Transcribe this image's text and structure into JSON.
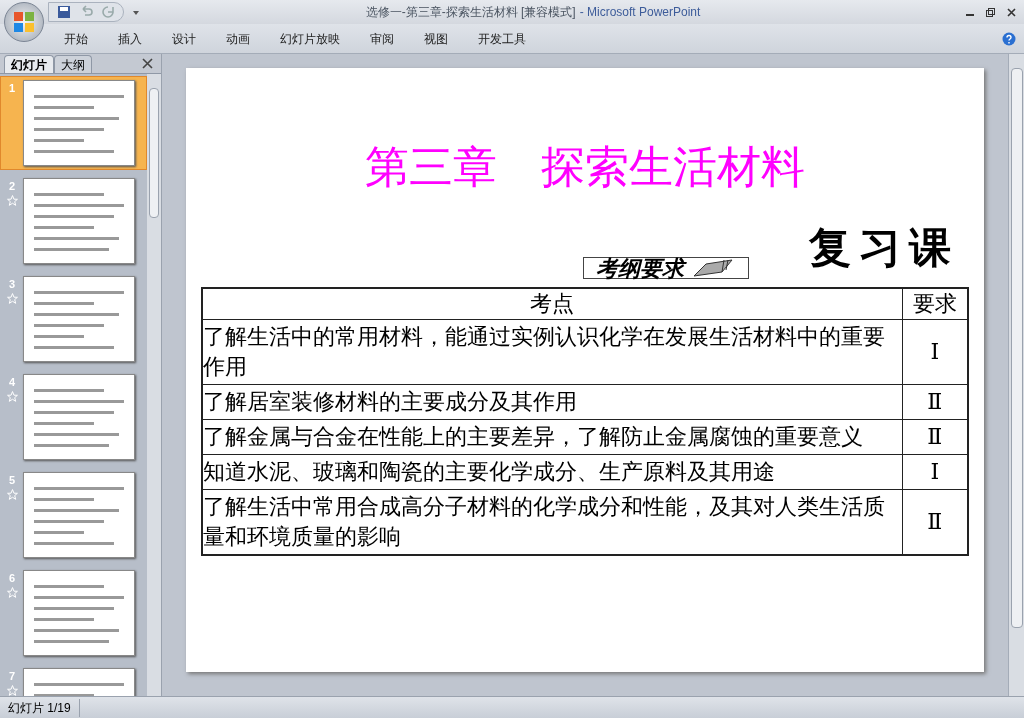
{
  "window": {
    "title": "选修一-第三章-探索生活材料 [兼容模式]",
    "separator": "-",
    "app": "Microsoft PowerPoint"
  },
  "ribbon_tabs": [
    {
      "label": "开始",
      "selected": false
    },
    {
      "label": "插入",
      "selected": false
    },
    {
      "label": "设计",
      "selected": false
    },
    {
      "label": "动画",
      "selected": false
    },
    {
      "label": "幻灯片放映",
      "selected": false
    },
    {
      "label": "审阅",
      "selected": false
    },
    {
      "label": "视图",
      "selected": false
    },
    {
      "label": "开发工具",
      "selected": false
    }
  ],
  "pane_tabs": [
    {
      "label": "幻灯片",
      "selected": true
    },
    {
      "label": "大纲",
      "selected": false
    }
  ],
  "thumbnails": [
    {
      "number": "1",
      "selected": true,
      "animated": false
    },
    {
      "number": "2",
      "selected": false,
      "animated": true
    },
    {
      "number": "3",
      "selected": false,
      "animated": true
    },
    {
      "number": "4",
      "selected": false,
      "animated": true
    },
    {
      "number": "5",
      "selected": false,
      "animated": true
    },
    {
      "number": "6",
      "selected": false,
      "animated": true
    },
    {
      "number": "7",
      "selected": false,
      "animated": true
    }
  ],
  "slide": {
    "title": "第三章　探索生活材料",
    "banner": "考纲要求",
    "subtitle": "复习课",
    "table": {
      "columns": [
        "考点",
        "要求"
      ],
      "rows": [
        [
          "了解生活中的常用材料，能通过实例认识化学在发展生活材料中的重要作用",
          "Ⅰ"
        ],
        [
          "了解居室装修材料的主要成分及其作用",
          "Ⅱ"
        ],
        [
          "了解金属与合金在性能上的主要差异，了解防止金属腐蚀的重要意义",
          "Ⅱ"
        ],
        [
          "知道水泥、玻璃和陶瓷的主要化学成分、生产原料及其用途",
          "Ⅰ"
        ],
        [
          "了解生活中常用合成高分子材料的化学成分和性能，及其对人类生活质量和环境质量的影响",
          "Ⅱ"
        ]
      ]
    }
  },
  "status_bar": {
    "slide_count": "幻灯片 1/19"
  }
}
